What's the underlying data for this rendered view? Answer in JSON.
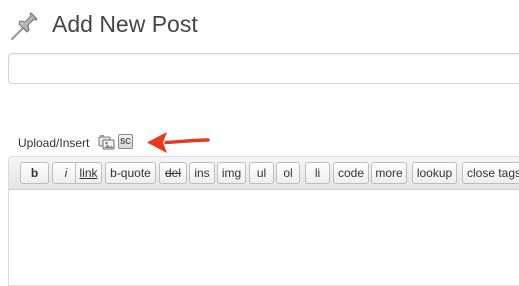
{
  "page": {
    "title": "Add New Post",
    "title_icon": "pushpin-icon"
  },
  "post_title": {
    "value": "",
    "placeholder": ""
  },
  "media": {
    "label": "Upload/Insert",
    "icons": [
      "media-upload-icon",
      "shortcode-icon"
    ],
    "shortcode_icon_text": "SC"
  },
  "annotation": {
    "type": "arrow",
    "color": "#e8391d",
    "points_to": "shortcode-icon"
  },
  "quicktags": {
    "buttons": [
      "b",
      "i",
      "link",
      "b-quote",
      "del",
      "ins",
      "img",
      "ul",
      "ol",
      "li",
      "code",
      "more",
      "lookup",
      "close tags"
    ]
  },
  "editor": {
    "content": ""
  }
}
